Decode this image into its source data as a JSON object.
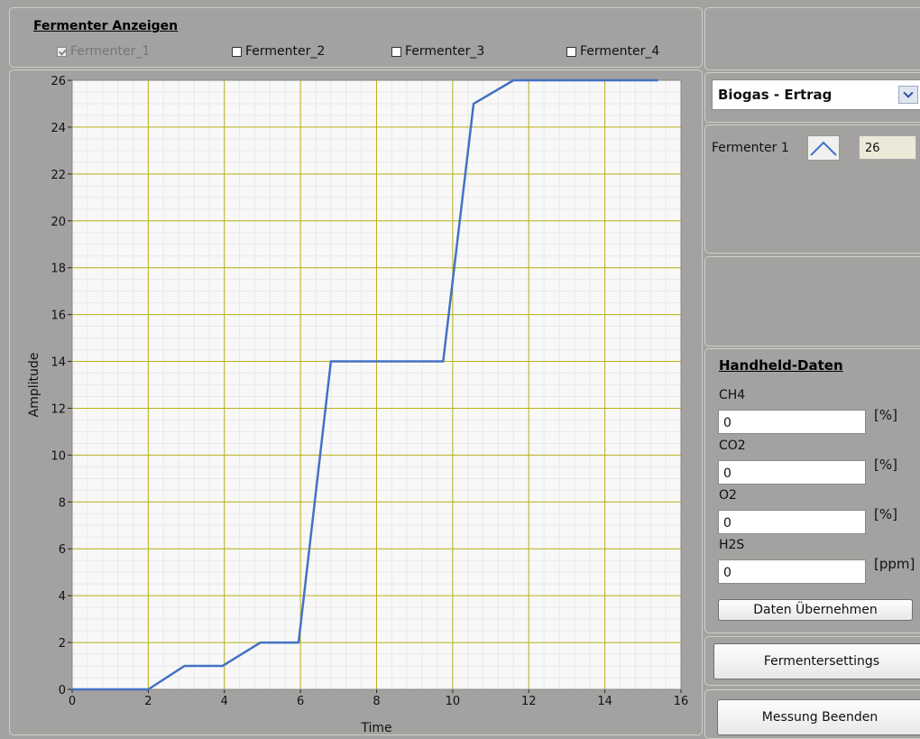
{
  "fermenter_panel": {
    "title": "Fermenter Anzeigen",
    "checkboxes": [
      {
        "label": "Fermenter_1",
        "checked": true,
        "disabled": true
      },
      {
        "label": "Fermenter_2",
        "checked": false
      },
      {
        "label": "Fermenter_3",
        "checked": false
      },
      {
        "label": "Fermenter_4",
        "checked": false
      }
    ]
  },
  "view_select": {
    "value": "Biogas - Ertrag"
  },
  "legend": {
    "name": "Fermenter 1",
    "value": "26"
  },
  "handheld": {
    "title": "Handheld-Daten",
    "fields": [
      {
        "label": "CH4",
        "value": "0",
        "unit": "[%]"
      },
      {
        "label": "CO2",
        "value": "0",
        "unit": "[%]"
      },
      {
        "label": "O2",
        "value": "0",
        "unit": "[%]"
      },
      {
        "label": "H2S",
        "value": "0",
        "unit": "[ppm]"
      }
    ],
    "apply_label": "Daten Übernehmen"
  },
  "buttons": {
    "settings": "Fermentersettings",
    "stop": "Messung Beenden"
  },
  "colors": {
    "line": "#4472c4",
    "grid_major": "#b8b21a",
    "plot_bg": "#f8f8f8"
  },
  "chart_data": {
    "type": "line",
    "xlabel": "Time",
    "ylabel": "Amplitude",
    "xlim": [
      0,
      16
    ],
    "ylim": [
      0,
      26
    ],
    "xticks": [
      0,
      2,
      4,
      6,
      8,
      10,
      12,
      14,
      16
    ],
    "yticks": [
      0,
      2,
      4,
      6,
      8,
      10,
      12,
      14,
      16,
      18,
      20,
      22,
      24,
      26
    ],
    "grid": true,
    "series": [
      {
        "name": "Fermenter 1",
        "x": [
          0,
          2,
          2.95,
          3.95,
          4.95,
          5.95,
          6.8,
          9.75,
          10.55,
          11.6,
          15.4
        ],
        "y": [
          0,
          0,
          1,
          1,
          2,
          2,
          14,
          14,
          25,
          26,
          26
        ]
      }
    ]
  }
}
